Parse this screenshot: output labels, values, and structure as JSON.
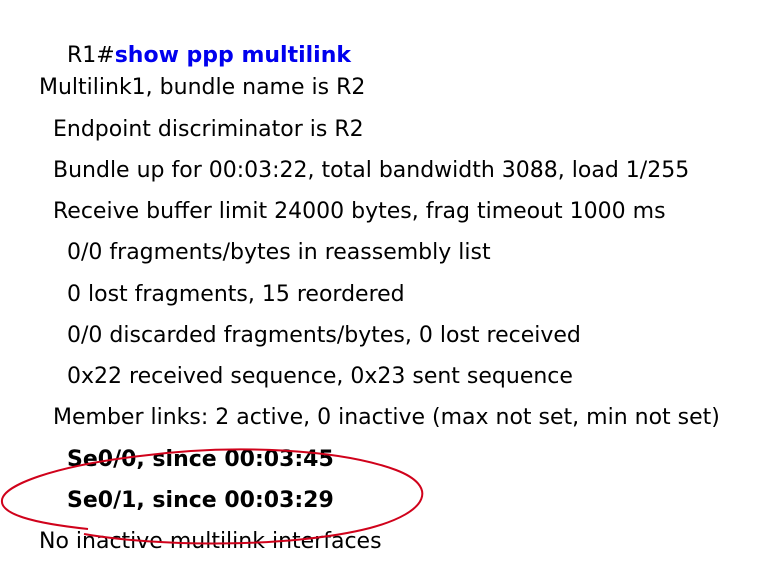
{
  "terminal": {
    "prompt": "R1#",
    "command": "show ppp multilink",
    "output": [
      "Multilink1, bundle name is R2",
      "Endpoint discriminator is R2",
      "Bundle up for 00:03:22, total bandwidth 3088, load 1/255",
      "Receive buffer limit 24000 bytes, frag timeout 1000 ms",
      "0/0 fragments/bytes in reassembly list",
      "0 lost fragments, 15 reordered",
      "0/0 discarded fragments/bytes, 0 lost received",
      "0x22 received sequence, 0x23 sent sequence",
      "Member links: 2 active, 0 inactive (max not set, min not set)",
      "Se0/0, since 00:03:45",
      "Se0/1, since 00:03:29",
      "No inactive multilink interfaces"
    ]
  },
  "colors": {
    "command": "#0000ee",
    "text": "#000000",
    "annotation": "#d0021b"
  }
}
